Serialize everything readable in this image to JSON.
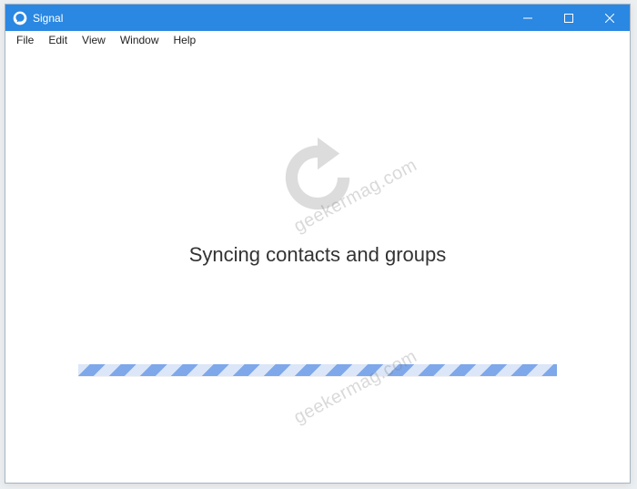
{
  "titlebar": {
    "app_name": "Signal"
  },
  "menubar": {
    "items": [
      "File",
      "Edit",
      "View",
      "Window",
      "Help"
    ]
  },
  "main": {
    "status_text": "Syncing contacts and groups"
  },
  "watermark": {
    "text": "geekermag.com"
  },
  "colors": {
    "titlebar_bg": "#2a87e2",
    "progress_stripe_a": "#7ea8ea",
    "progress_stripe_b": "#dbe6f8",
    "sync_icon": "#dcdcdc"
  }
}
